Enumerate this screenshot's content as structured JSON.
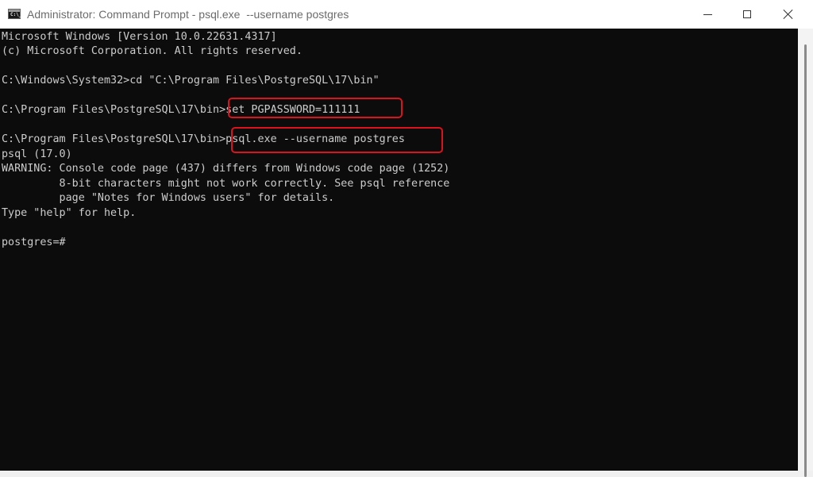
{
  "window": {
    "title": "Administrator: Command Prompt - psql.exe  --username postgres"
  },
  "icons": {
    "app": "command-prompt-icon",
    "minimize": "minimize-icon",
    "maximize": "maximize-icon",
    "close": "close-icon"
  },
  "app_icon_text": "C:\\_",
  "console": {
    "lines": [
      "Microsoft Windows [Version 10.0.22631.4317]",
      "(c) Microsoft Corporation. All rights reserved.",
      "",
      "C:\\Windows\\System32>cd \"C:\\Program Files\\PostgreSQL\\17\\bin\"",
      "",
      "C:\\Program Files\\PostgreSQL\\17\\bin>set PGPASSWORD=111111",
      "",
      "C:\\Program Files\\PostgreSQL\\17\\bin>psql.exe --username postgres",
      "psql (17.0)",
      "WARNING: Console code page (437) differs from Windows code page (1252)",
      "         8-bit characters might not work correctly. See psql reference",
      "         page \"Notes for Windows users\" for details.",
      "Type \"help\" for help.",
      "",
      "postgres=#"
    ]
  },
  "colors": {
    "console_bg": "#0c0c0c",
    "console_text": "#cccccc",
    "highlight": "#d9141e"
  }
}
